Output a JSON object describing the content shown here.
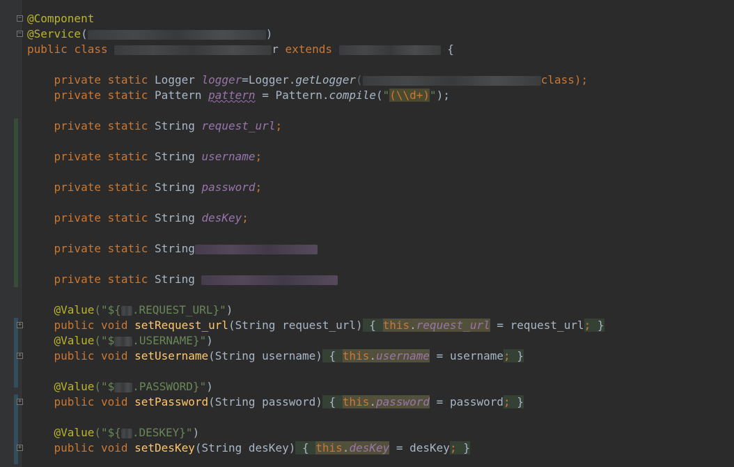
{
  "code": {
    "l1_ann": "@Component",
    "l2_ann": "@Service",
    "l2_open": "(",
    "l2_close": ")",
    "public": "public",
    "class": "class",
    "extends": "extends",
    "cls_suffix": "r",
    "brace_open": "{",
    "private": "private",
    "static": "static",
    "void": "void",
    "this": "this",
    "dot": ".",
    "semi": ";",
    "eq": " = ",
    "brace_close": "}",
    "logger_type": "Logger",
    "logger_field": "logger",
    "logger_assign": "=Logger.",
    "get_logger": "getLogger",
    "logger_paren": "(",
    "logger_tail": "class);",
    "pattern_type": "Pattern",
    "pattern_field": "pattern",
    "pattern_assign": " = Pattern.",
    "compile": "compile",
    "compile_open": "(",
    "regex_q1": "\"",
    "regex_body": "(\\\\d+)",
    "regex_q2": "\"",
    "compile_close": ");",
    "string_type": "String",
    "f_request_url": "request_url",
    "f_username": "username",
    "f_password": "password",
    "f_deskey": "desKey",
    "value_ann": "@Value",
    "v1_a": "(\"${",
    "v1_b": ".REQUEST_URL}\"",
    "v1_c": ")",
    "v2_a": "(\"$",
    "v2_b": ".USERNAME}\"",
    "v2_c": ")",
    "v3_a": "(\"$",
    "v3_b": ".PASSWORD}\"",
    "v3_c": ")",
    "v4_a": "(\"${",
    "v4_b": ".DESKEY}\"",
    "v4_c": ")",
    "m_set_request_url": "setRequest_url",
    "m_set_username": "setUsername",
    "m_set_password": "setPassword",
    "m_set_deskey": "setDesKey",
    "p_request_url": "(String request_url)",
    "p_username": "(String username)",
    "p_password": "(String password)",
    "p_deskey": "(String desKey)",
    "a_request_url": "request_url",
    "a_username": "username",
    "a_password": "password",
    "a_deskey": "desKey"
  },
  "icons": {
    "fold_expand": "plus-icon",
    "fold_collapse": "minus-icon"
  },
  "colors": {
    "background": "#2b2b2b",
    "keyword": "#cc7832",
    "annotation": "#bbb529",
    "field": "#9876aa",
    "method": "#ffc66d",
    "string": "#6a8759",
    "text": "#a9b7c6"
  }
}
